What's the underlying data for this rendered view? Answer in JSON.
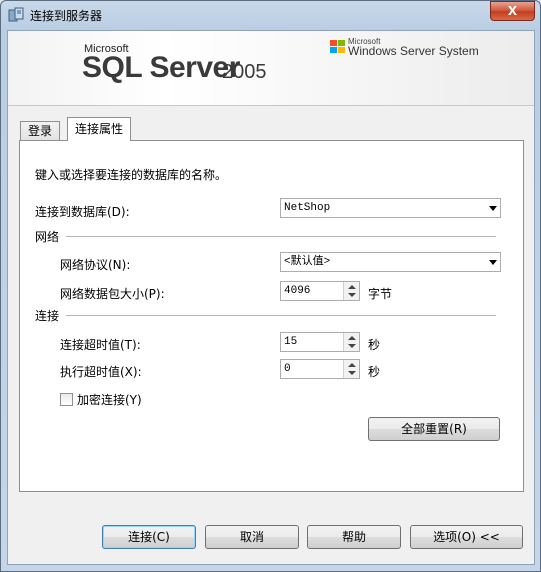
{
  "window": {
    "title": "连接到服务器",
    "close_glyph": "X"
  },
  "banner": {
    "microsoft": "Microsoft",
    "product": "SQL Server",
    "version": "2005",
    "wss_microsoft": "Microsoft",
    "wss_name": "Windows Server System"
  },
  "tabs": [
    {
      "label": "登录",
      "active": false
    },
    {
      "label": "连接属性",
      "active": true
    }
  ],
  "form": {
    "intro": "键入或选择要连接的数据库的名称。",
    "database_label": "连接到数据库(D):",
    "database_value": "NetShop",
    "network_section": "网络",
    "protocol_label": "网络协议(N):",
    "protocol_value": "<默认值>",
    "packet_label": "网络数据包大小(P):",
    "packet_value": "4096",
    "packet_unit": "字节",
    "connection_section": "连接",
    "conn_timeout_label": "连接超时值(T):",
    "conn_timeout_value": "15",
    "conn_timeout_unit": "秒",
    "exec_timeout_label": "执行超时值(X):",
    "exec_timeout_value": "0",
    "exec_timeout_unit": "秒",
    "encrypt_label": "加密连接(Y)",
    "encrypt_checked": false,
    "reset_all": "全部重置(R)"
  },
  "footer": {
    "connect": "连接(C)",
    "cancel": "取消",
    "help": "帮助",
    "options": "选项(O) <<"
  }
}
